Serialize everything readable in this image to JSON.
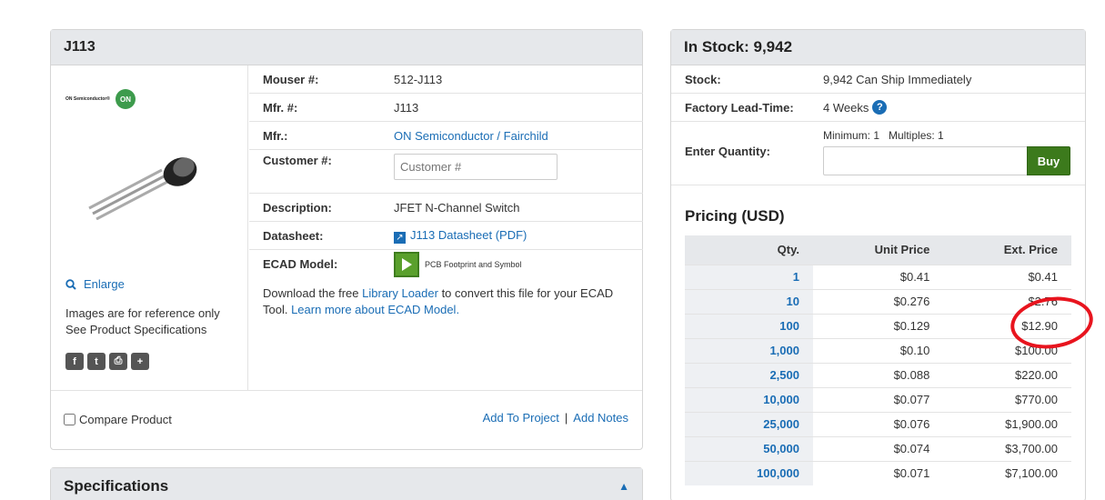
{
  "product": {
    "title": "J113",
    "logo_text": "ON Semiconductor®",
    "logo_badge": "ON",
    "enlarge_label": "Enlarge",
    "ref_line1": "Images are for reference only",
    "ref_line2": "See Product Specifications",
    "share_icons": [
      "facebook-icon",
      "twitter-icon",
      "print-icon",
      "plus-icon"
    ],
    "details": {
      "mouser_label": "Mouser #:",
      "mouser_value": "512-J113",
      "mfr_num_label": "Mfr. #:",
      "mfr_num_value": "J113",
      "mfr_label": "Mfr.:",
      "mfr_value": "ON Semiconductor / Fairchild",
      "customer_label": "Customer #:",
      "customer_placeholder": "Customer #",
      "description_label": "Description:",
      "description_value": "JFET N-Channel Switch",
      "datasheet_label": "Datasheet:",
      "datasheet_value": "J113 Datasheet (PDF)",
      "ecad_label": "ECAD Model:",
      "ecad_value": "PCB Footprint and Symbol",
      "download_pre": "Download the free ",
      "download_link": "Library Loader",
      "download_mid": " to convert this file for your ECAD Tool. ",
      "download_link2": "Learn more about ECAD Model."
    },
    "compare_label": "Compare Product",
    "add_project": "Add To Project",
    "separator": "|",
    "add_notes": "Add Notes"
  },
  "specs": {
    "title": "Specifications"
  },
  "stock": {
    "title": "In Stock: 9,942",
    "stock_label": "Stock:",
    "stock_value": "9,942 Can Ship Immediately",
    "lead_label": "Factory Lead-Time:",
    "lead_value": "4 Weeks",
    "qty_label": "Enter Quantity:",
    "min_mult": "Minimum: 1   Multiples: 1",
    "buy_label": "Buy",
    "pricing_title": "Pricing (USD)",
    "headers": {
      "qty": "Qty.",
      "unit": "Unit Price",
      "ext": "Ext. Price"
    },
    "rows": [
      {
        "qty": "1",
        "unit": "$0.41",
        "ext": "$0.41"
      },
      {
        "qty": "10",
        "unit": "$0.276",
        "ext": "$2.76"
      },
      {
        "qty": "100",
        "unit": "$0.129",
        "ext": "$12.90"
      },
      {
        "qty": "1,000",
        "unit": "$0.10",
        "ext": "$100.00"
      },
      {
        "qty": "2,500",
        "unit": "$0.088",
        "ext": "$220.00"
      },
      {
        "qty": "10,000",
        "unit": "$0.077",
        "ext": "$770.00"
      },
      {
        "qty": "25,000",
        "unit": "$0.076",
        "ext": "$1,900.00"
      },
      {
        "qty": "50,000",
        "unit": "$0.074",
        "ext": "$3,700.00"
      },
      {
        "qty": "100,000",
        "unit": "$0.071",
        "ext": "$7,100.00"
      }
    ]
  },
  "colors": {
    "accent": "#1a6db5",
    "buy": "#3c7a1c",
    "highlight": "#e8141e"
  }
}
